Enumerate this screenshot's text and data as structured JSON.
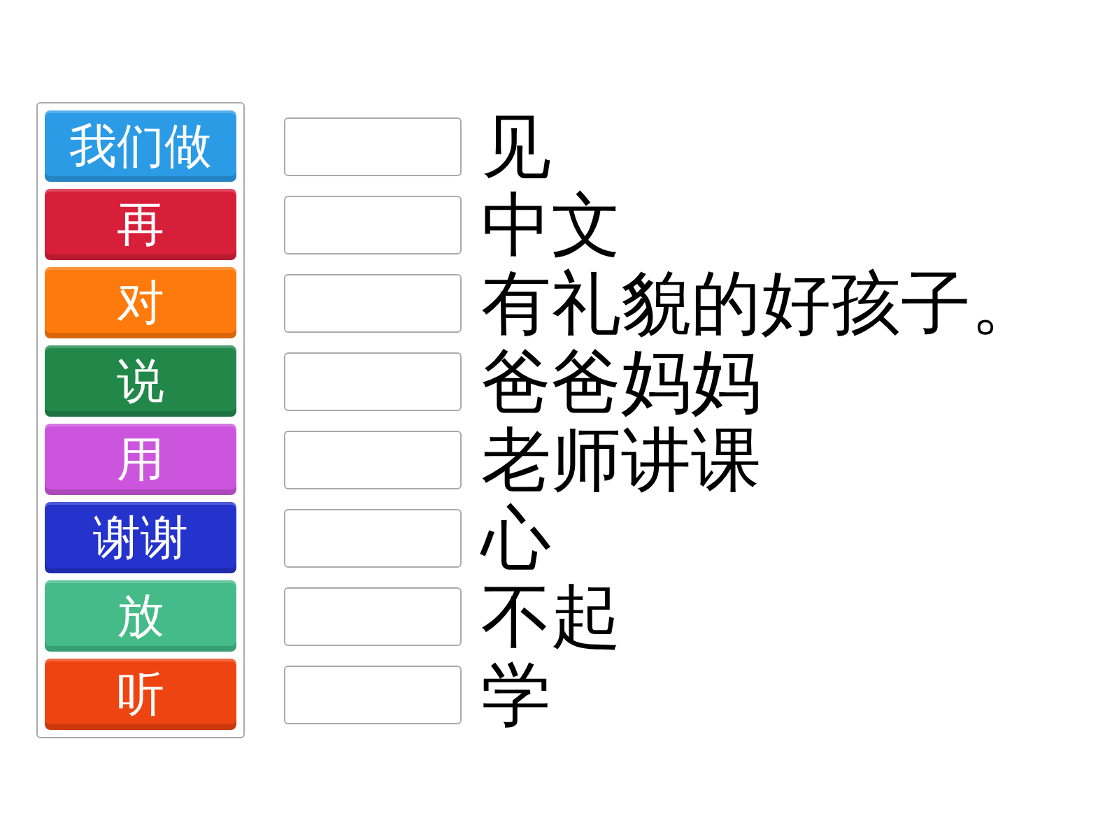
{
  "word_bank": {
    "tiles": [
      {
        "text": "我们做",
        "color": "#2b9be6"
      },
      {
        "text": "再",
        "color": "#d81f3a"
      },
      {
        "text": "对",
        "color": "#ff7a0c"
      },
      {
        "text": "说",
        "color": "#22884a"
      },
      {
        "text": "用",
        "color": "#cc55dd"
      },
      {
        "text": "谢谢",
        "color": "#2433cc"
      },
      {
        "text": "放",
        "color": "#44bb88"
      },
      {
        "text": "听",
        "color": "#ee4411"
      }
    ]
  },
  "rows": [
    {
      "text": "见"
    },
    {
      "text": "中文"
    },
    {
      "text": "有礼貌的好孩子。"
    },
    {
      "text": "爸爸妈妈"
    },
    {
      "text": "老师讲课"
    },
    {
      "text": "心"
    },
    {
      "text": "不起"
    },
    {
      "text": "学"
    }
  ]
}
